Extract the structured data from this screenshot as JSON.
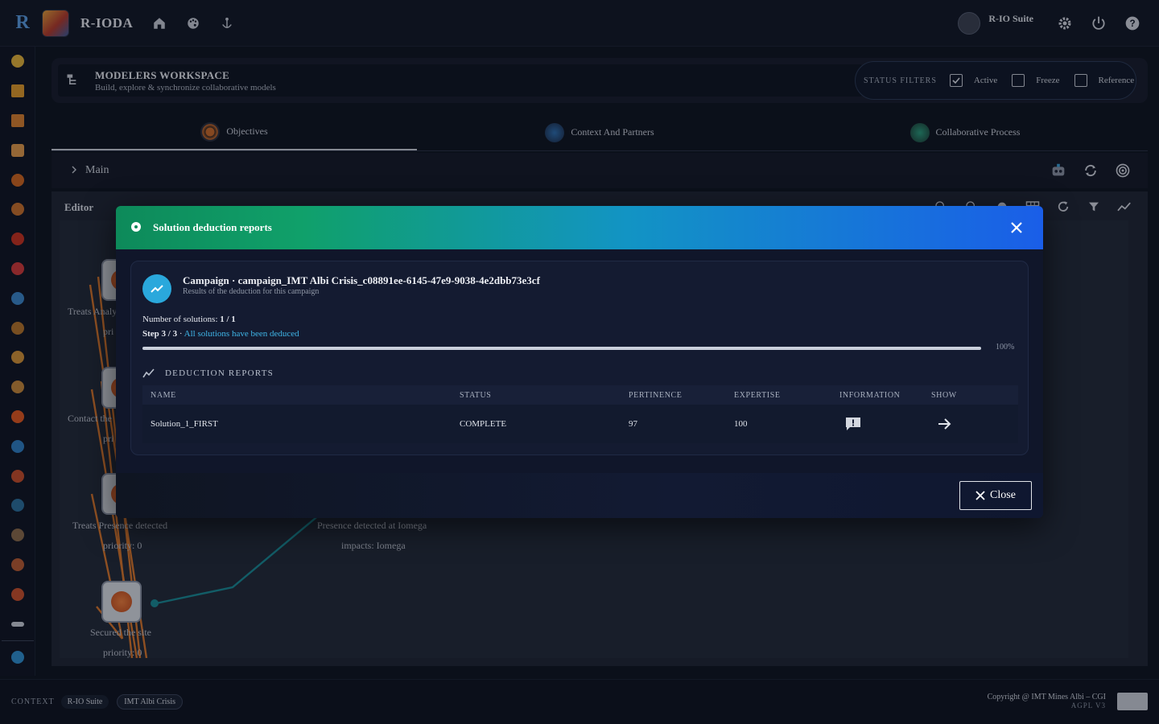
{
  "app": {
    "brand": "R-IODA",
    "suite_label": "R-IO Suite"
  },
  "workspace": {
    "title": "MODELERS WORKSPACE",
    "subtitle": "Build, explore & synchronize collaborative models",
    "filters_label": "STATUS FILTERS",
    "filters": [
      {
        "label": "Active",
        "checked": true
      },
      {
        "label": "Freeze",
        "checked": false
      },
      {
        "label": "Reference",
        "checked": false
      }
    ]
  },
  "tabs": [
    {
      "label": "Objectives",
      "active": true,
      "icon": "target-icon"
    },
    {
      "label": "Context And Partners",
      "active": false,
      "icon": "globe-icon"
    },
    {
      "label": "Collaborative Process",
      "active": false,
      "icon": "process-icon"
    }
  ],
  "breadcrumb": {
    "label": "Main"
  },
  "editor": {
    "title": "Editor",
    "nodes": [
      {
        "label": "Treats Analy",
        "sub": "pri"
      },
      {
        "label": "Contact the",
        "sub": "pri"
      },
      {
        "label": "Treats Presence detected",
        "sub": "priority: 0"
      },
      {
        "label": "Secured the site",
        "sub": "priority: 0"
      },
      {
        "label": "Presence detected at Iomega",
        "sub": "impacts: Iomega"
      }
    ]
  },
  "modal": {
    "title": "Solution deduction reports",
    "campaign_title": "Campaign · campaign_IMT Albi Crisis_c08891ee-6145-47e9-9038-4e2dbb73e3cf",
    "campaign_subtitle": "Results of the deduction for this campaign",
    "solutions_label": "Number of solutions:",
    "solutions_value": "1 / 1",
    "step_label": "Step 3 / 3",
    "step_status": "All solutions have been deduced",
    "progress": 1.0,
    "progress_label": "100%",
    "reports_title": "DEDUCTION REPORTS",
    "columns": [
      "NAME",
      "STATUS",
      "PERTINENCE",
      "EXPERTISE",
      "INFORMATION",
      "SHOW"
    ],
    "rows": [
      {
        "name": "Solution_1_FIRST",
        "status": "COMPLETE",
        "pertinence": "97",
        "expertise": "100"
      }
    ],
    "close_label": "Close"
  },
  "statusbar": {
    "context_label": "CONTEXT",
    "chips": [
      "R-IO Suite",
      "IMT Albi Crisis"
    ],
    "copyright": "Copyright @ IMT Mines Albi – CGI",
    "license": "AGPL V3"
  },
  "colors": {
    "accent": "#2aa8dc",
    "header_gradient_start": "#0d8a5a",
    "header_gradient_end": "#1a5ee8",
    "edge_orange": "#d9772b",
    "edge_teal": "#1a8a96"
  }
}
